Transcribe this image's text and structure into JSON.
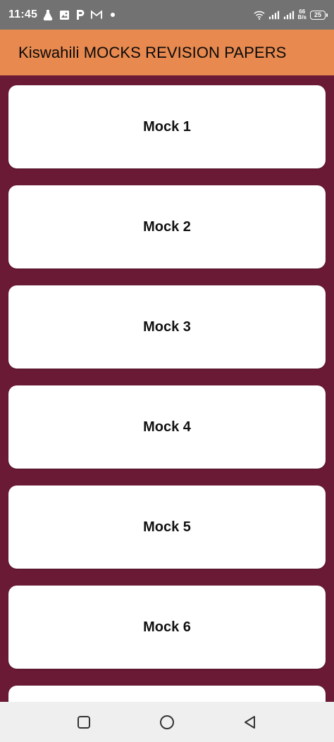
{
  "status_bar": {
    "time": "11:45",
    "speed_value": "66",
    "speed_unit": "B/s",
    "battery_level": "25",
    "left_icons": [
      "flask-icon",
      "image-icon",
      "p-app-icon",
      "gmail-icon",
      "dot-icon"
    ],
    "right_icons": [
      "wifi-icon",
      "signal-icon",
      "signal-icon"
    ]
  },
  "app_bar": {
    "title": "Kiswahili MOCKS REVISION PAPERS",
    "color": "#e8894f"
  },
  "list": {
    "background": "#6b1a35",
    "items": [
      {
        "label": "Mock 1"
      },
      {
        "label": "Mock 2"
      },
      {
        "label": "Mock 3"
      },
      {
        "label": "Mock 4"
      },
      {
        "label": "Mock 5"
      },
      {
        "label": "Mock 6"
      },
      {
        "label": ""
      }
    ]
  },
  "nav_bar": {
    "buttons": [
      "square-icon",
      "circle-icon",
      "back-triangle-icon"
    ]
  }
}
